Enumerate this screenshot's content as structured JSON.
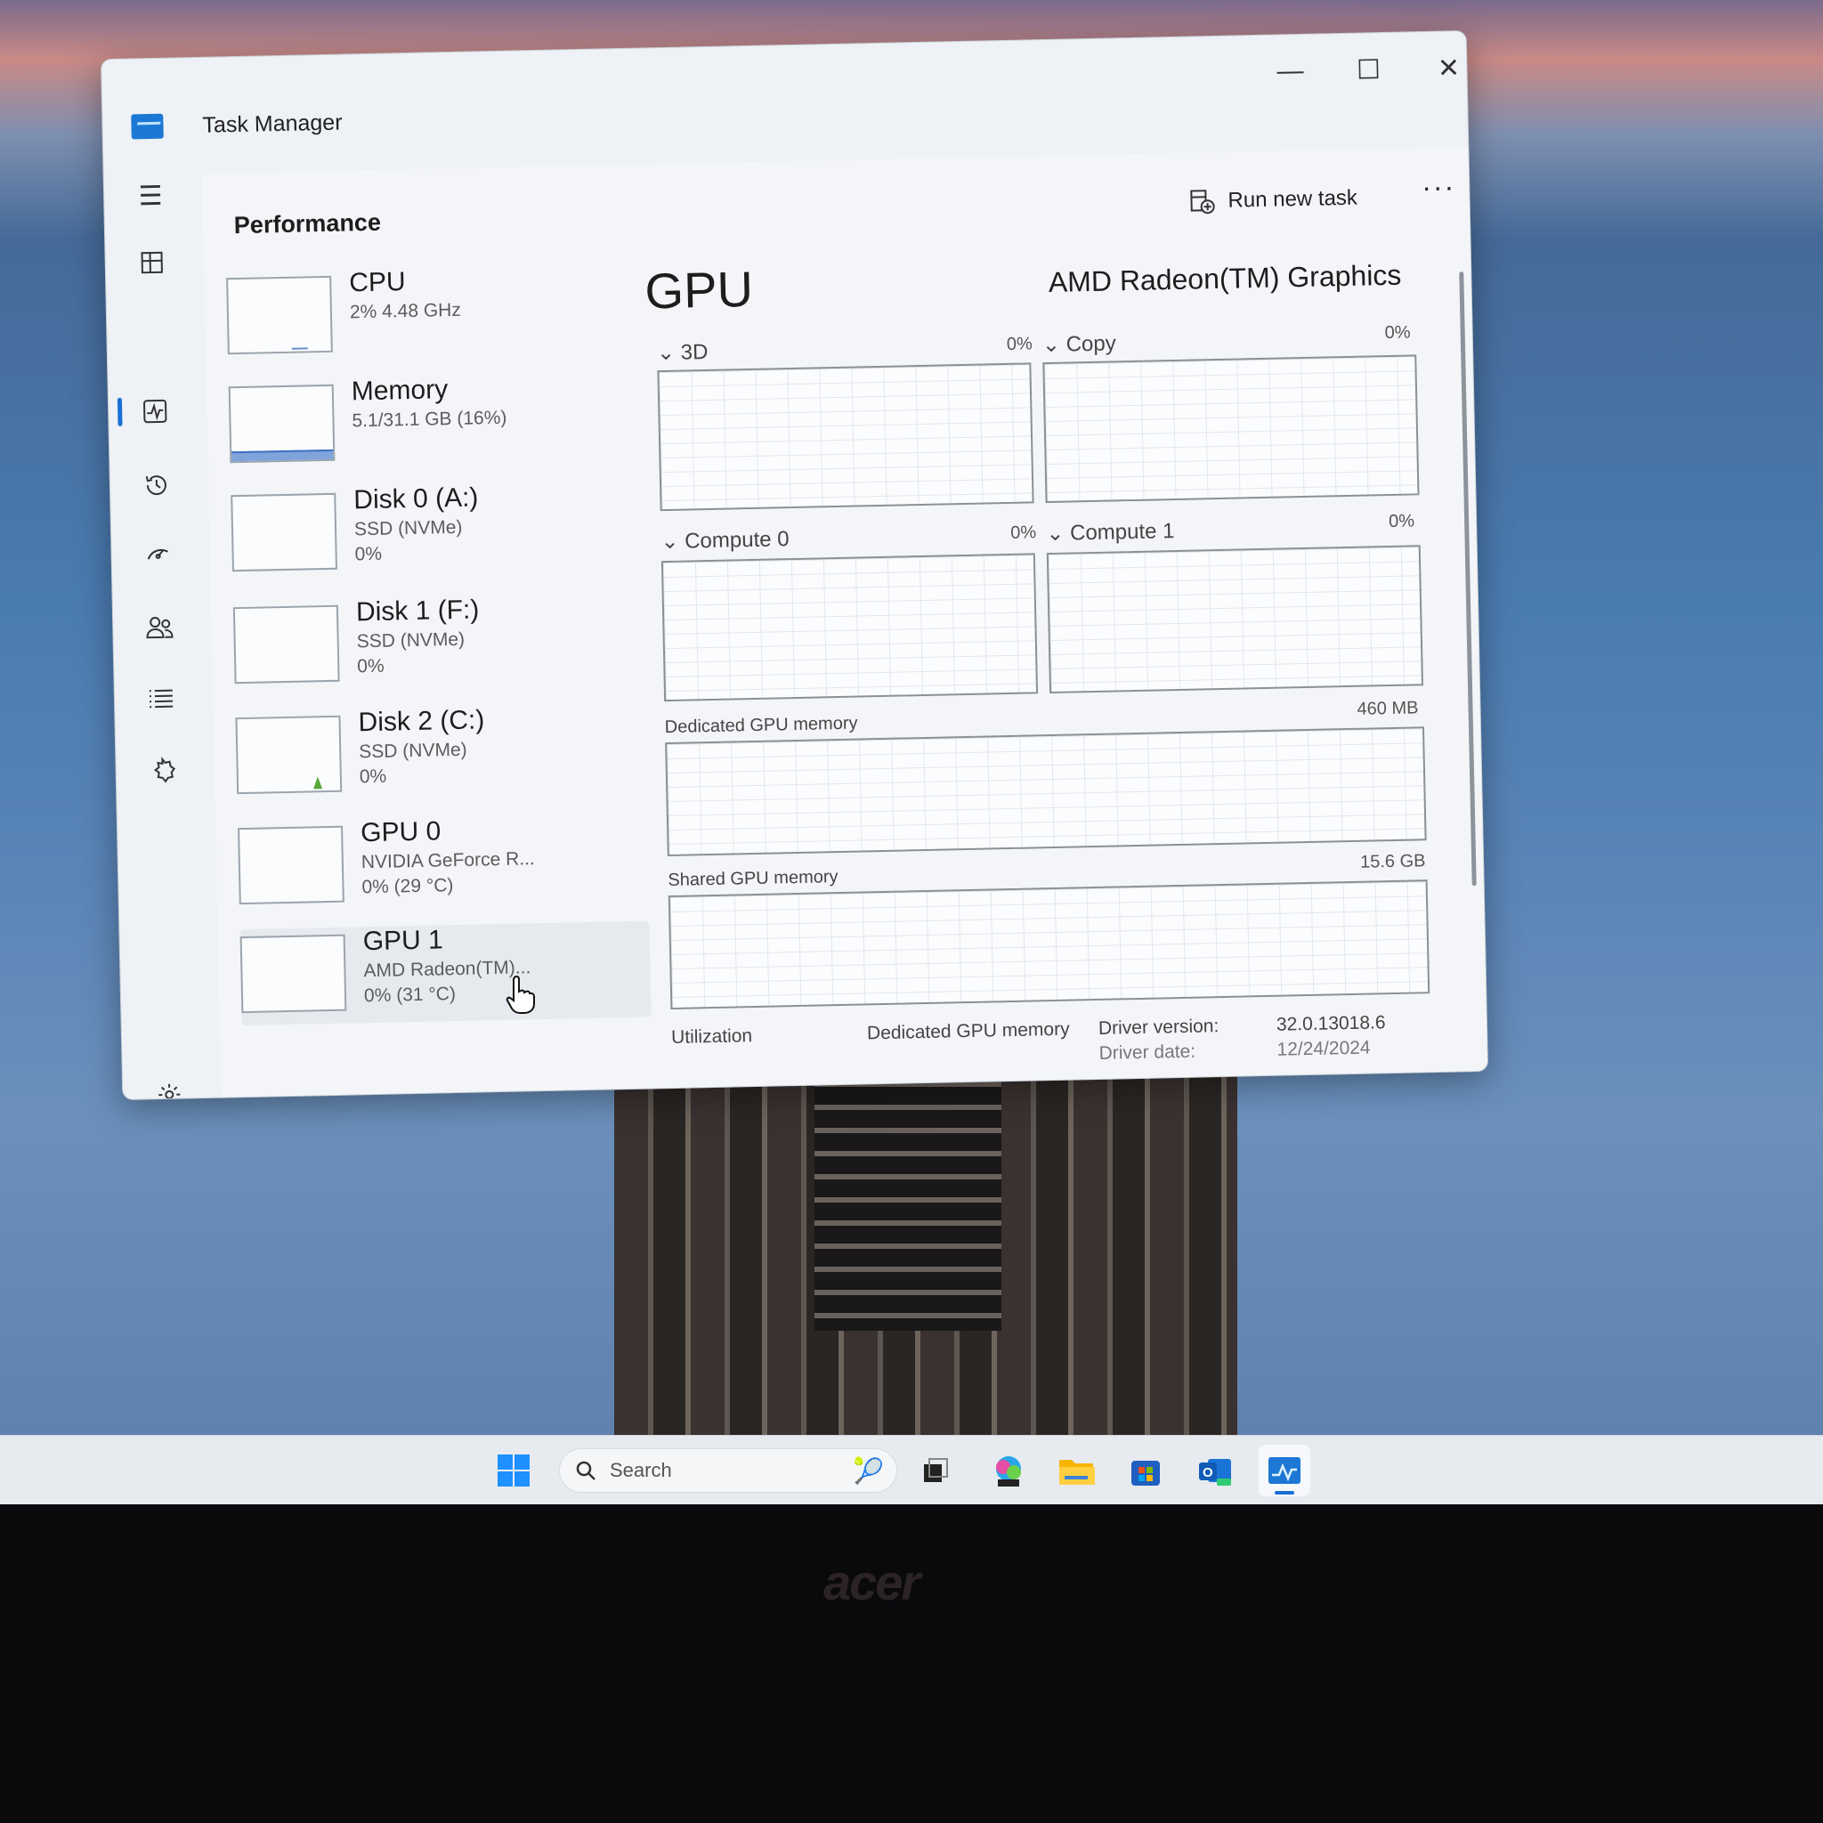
{
  "window": {
    "title": "Task Manager",
    "controls": {
      "minimize": "—",
      "maximize": "☐",
      "close": "✕"
    }
  },
  "nav": {
    "icons": [
      "hamburger-icon",
      "processes-icon",
      "performance-icon",
      "app-history-icon",
      "startup-apps-icon",
      "users-icon",
      "details-icon",
      "services-icon",
      "settings-icon"
    ]
  },
  "header": {
    "title": "Performance",
    "run_new_task": "Run new task",
    "more": "···"
  },
  "devices": [
    {
      "name": "CPU",
      "sub1": "2% 4.48 GHz",
      "sub2": ""
    },
    {
      "name": "Memory",
      "sub1": "5.1/31.1 GB (16%)",
      "sub2": "",
      "fill_fraction": 0.16
    },
    {
      "name": "Disk 0 (A:)",
      "sub1": "SSD (NVMe)",
      "sub2": "0%"
    },
    {
      "name": "Disk 1 (F:)",
      "sub1": "SSD (NVMe)",
      "sub2": "0%"
    },
    {
      "name": "Disk 2 (C:)",
      "sub1": "SSD (NVMe)",
      "sub2": "0%"
    },
    {
      "name": "GPU 0",
      "sub1": "NVIDIA GeForce R...",
      "sub2": "0% (29 °C)"
    },
    {
      "name": "GPU 1",
      "sub1": "AMD Radeon(TM)...",
      "sub2": "0% (31 °C)"
    }
  ],
  "detail": {
    "title": "GPU",
    "model": "AMD Radeon(TM) Graphics",
    "engines": [
      {
        "label": "3D",
        "value": "0%"
      },
      {
        "label": "Copy",
        "value": "0%"
      },
      {
        "label": "Compute 0",
        "value": "0%"
      },
      {
        "label": "Compute 1",
        "value": "0%"
      }
    ],
    "dedicated_label": "Dedicated GPU memory",
    "dedicated_max": "460 MB",
    "shared_label": "Shared GPU memory",
    "shared_max": "15.6 GB",
    "stats": {
      "utilization_label": "Utilization",
      "dedicated_label": "Dedicated GPU memory",
      "driver_version_label": "Driver version:",
      "driver_version": "32.0.13018.6",
      "driver_date_label": "Driver date:",
      "driver_date": "12/24/2024"
    }
  },
  "taskbar": {
    "search_placeholder": "Search",
    "apps": [
      "start-icon",
      "task-view-icon",
      "m365-icon",
      "file-explorer-icon",
      "store-icon",
      "outlook-icon",
      "task-manager-icon"
    ]
  },
  "monitor": {
    "brand": "acer"
  },
  "colors": {
    "accent": "#1a6fd6",
    "memory_fill": "#7fa4dc",
    "taskbar": "#e7ebf0"
  }
}
